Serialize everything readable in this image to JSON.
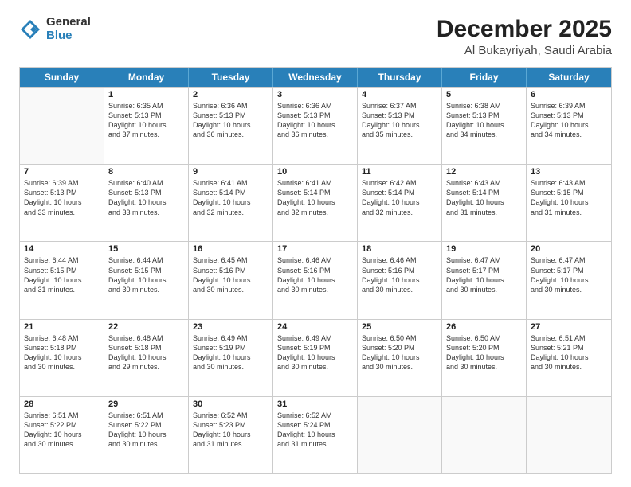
{
  "logo": {
    "general": "General",
    "blue": "Blue"
  },
  "header": {
    "title": "December 2025",
    "subtitle": "Al Bukayriyah, Saudi Arabia"
  },
  "weekdays": [
    "Sunday",
    "Monday",
    "Tuesday",
    "Wednesday",
    "Thursday",
    "Friday",
    "Saturday"
  ],
  "rows": [
    [
      {
        "day": "",
        "info": ""
      },
      {
        "day": "1",
        "info": "Sunrise: 6:35 AM\nSunset: 5:13 PM\nDaylight: 10 hours\nand 37 minutes."
      },
      {
        "day": "2",
        "info": "Sunrise: 6:36 AM\nSunset: 5:13 PM\nDaylight: 10 hours\nand 36 minutes."
      },
      {
        "day": "3",
        "info": "Sunrise: 6:36 AM\nSunset: 5:13 PM\nDaylight: 10 hours\nand 36 minutes."
      },
      {
        "day": "4",
        "info": "Sunrise: 6:37 AM\nSunset: 5:13 PM\nDaylight: 10 hours\nand 35 minutes."
      },
      {
        "day": "5",
        "info": "Sunrise: 6:38 AM\nSunset: 5:13 PM\nDaylight: 10 hours\nand 34 minutes."
      },
      {
        "day": "6",
        "info": "Sunrise: 6:39 AM\nSunset: 5:13 PM\nDaylight: 10 hours\nand 34 minutes."
      }
    ],
    [
      {
        "day": "7",
        "info": "Sunrise: 6:39 AM\nSunset: 5:13 PM\nDaylight: 10 hours\nand 33 minutes."
      },
      {
        "day": "8",
        "info": "Sunrise: 6:40 AM\nSunset: 5:13 PM\nDaylight: 10 hours\nand 33 minutes."
      },
      {
        "day": "9",
        "info": "Sunrise: 6:41 AM\nSunset: 5:14 PM\nDaylight: 10 hours\nand 32 minutes."
      },
      {
        "day": "10",
        "info": "Sunrise: 6:41 AM\nSunset: 5:14 PM\nDaylight: 10 hours\nand 32 minutes."
      },
      {
        "day": "11",
        "info": "Sunrise: 6:42 AM\nSunset: 5:14 PM\nDaylight: 10 hours\nand 32 minutes."
      },
      {
        "day": "12",
        "info": "Sunrise: 6:43 AM\nSunset: 5:14 PM\nDaylight: 10 hours\nand 31 minutes."
      },
      {
        "day": "13",
        "info": "Sunrise: 6:43 AM\nSunset: 5:15 PM\nDaylight: 10 hours\nand 31 minutes."
      }
    ],
    [
      {
        "day": "14",
        "info": "Sunrise: 6:44 AM\nSunset: 5:15 PM\nDaylight: 10 hours\nand 31 minutes."
      },
      {
        "day": "15",
        "info": "Sunrise: 6:44 AM\nSunset: 5:15 PM\nDaylight: 10 hours\nand 30 minutes."
      },
      {
        "day": "16",
        "info": "Sunrise: 6:45 AM\nSunset: 5:16 PM\nDaylight: 10 hours\nand 30 minutes."
      },
      {
        "day": "17",
        "info": "Sunrise: 6:46 AM\nSunset: 5:16 PM\nDaylight: 10 hours\nand 30 minutes."
      },
      {
        "day": "18",
        "info": "Sunrise: 6:46 AM\nSunset: 5:16 PM\nDaylight: 10 hours\nand 30 minutes."
      },
      {
        "day": "19",
        "info": "Sunrise: 6:47 AM\nSunset: 5:17 PM\nDaylight: 10 hours\nand 30 minutes."
      },
      {
        "day": "20",
        "info": "Sunrise: 6:47 AM\nSunset: 5:17 PM\nDaylight: 10 hours\nand 30 minutes."
      }
    ],
    [
      {
        "day": "21",
        "info": "Sunrise: 6:48 AM\nSunset: 5:18 PM\nDaylight: 10 hours\nand 30 minutes."
      },
      {
        "day": "22",
        "info": "Sunrise: 6:48 AM\nSunset: 5:18 PM\nDaylight: 10 hours\nand 29 minutes."
      },
      {
        "day": "23",
        "info": "Sunrise: 6:49 AM\nSunset: 5:19 PM\nDaylight: 10 hours\nand 30 minutes."
      },
      {
        "day": "24",
        "info": "Sunrise: 6:49 AM\nSunset: 5:19 PM\nDaylight: 10 hours\nand 30 minutes."
      },
      {
        "day": "25",
        "info": "Sunrise: 6:50 AM\nSunset: 5:20 PM\nDaylight: 10 hours\nand 30 minutes."
      },
      {
        "day": "26",
        "info": "Sunrise: 6:50 AM\nSunset: 5:20 PM\nDaylight: 10 hours\nand 30 minutes."
      },
      {
        "day": "27",
        "info": "Sunrise: 6:51 AM\nSunset: 5:21 PM\nDaylight: 10 hours\nand 30 minutes."
      }
    ],
    [
      {
        "day": "28",
        "info": "Sunrise: 6:51 AM\nSunset: 5:22 PM\nDaylight: 10 hours\nand 30 minutes."
      },
      {
        "day": "29",
        "info": "Sunrise: 6:51 AM\nSunset: 5:22 PM\nDaylight: 10 hours\nand 30 minutes."
      },
      {
        "day": "30",
        "info": "Sunrise: 6:52 AM\nSunset: 5:23 PM\nDaylight: 10 hours\nand 31 minutes."
      },
      {
        "day": "31",
        "info": "Sunrise: 6:52 AM\nSunset: 5:24 PM\nDaylight: 10 hours\nand 31 minutes."
      },
      {
        "day": "",
        "info": ""
      },
      {
        "day": "",
        "info": ""
      },
      {
        "day": "",
        "info": ""
      }
    ]
  ]
}
